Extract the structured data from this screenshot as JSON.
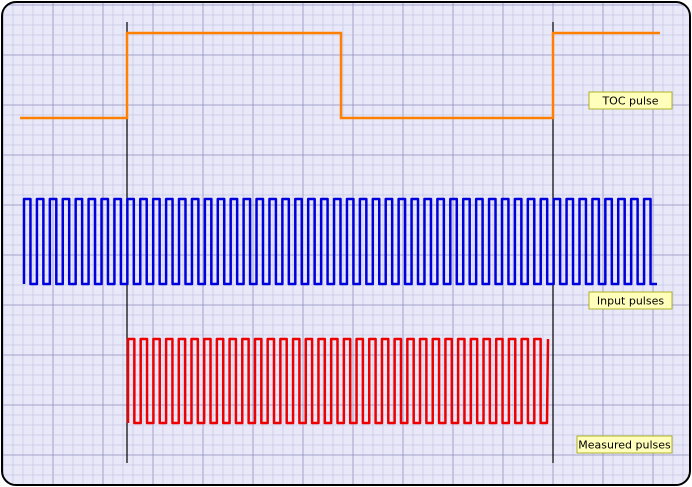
{
  "colors": {
    "background": "#e8e8f8",
    "grid_minor": "#b9b9dd",
    "grid_major": "#8f8fbf",
    "frame_border": "#000000",
    "marker": "#000000",
    "toc": "#ff8000",
    "input": "#0000dd",
    "measured": "#ee0000",
    "label_fill": "#ffffbb",
    "label_stroke": "#a0a000"
  },
  "labels": {
    "toc": "TOC pulse",
    "input": "Input pulses",
    "measured": "Measured pulses"
  },
  "waveforms": {
    "toc": {
      "levels": [
        "low",
        "high",
        "low",
        "high"
      ]
    },
    "input": {
      "cycles": 49
    },
    "measured": {
      "cycles": 33
    }
  },
  "icons": [
    "toc-pulse-waveform",
    "input-pulses-waveform",
    "measured-pulses-waveform",
    "time-marker-line"
  ]
}
